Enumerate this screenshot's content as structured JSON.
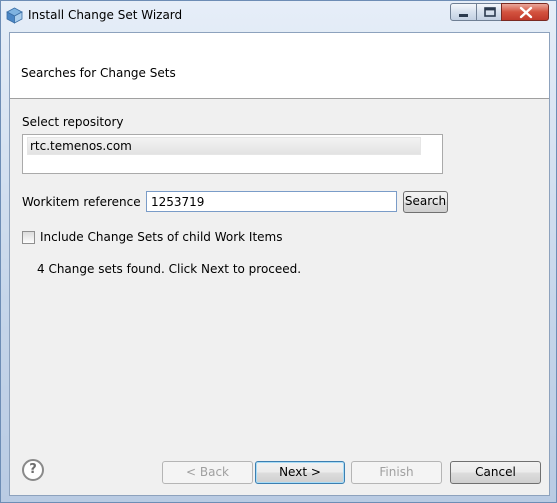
{
  "window": {
    "title": "Install Change Set Wizard"
  },
  "banner": {
    "title": "Searches for Change Sets"
  },
  "repository": {
    "label": "Select repository",
    "items": [
      "rtc.temenos.com"
    ]
  },
  "workitem": {
    "label": "Workitem reference",
    "value": "1253719",
    "search_button": "Search"
  },
  "options": {
    "include_child_label": "Include Change Sets of child Work Items",
    "include_child_checked": false
  },
  "status": {
    "message": "4 Change sets found. Click Next to proceed."
  },
  "footer": {
    "help_icon": "help-icon",
    "back_label": "< Back",
    "next_label": "Next >",
    "finish_label": "Finish",
    "cancel_label": "Cancel"
  }
}
